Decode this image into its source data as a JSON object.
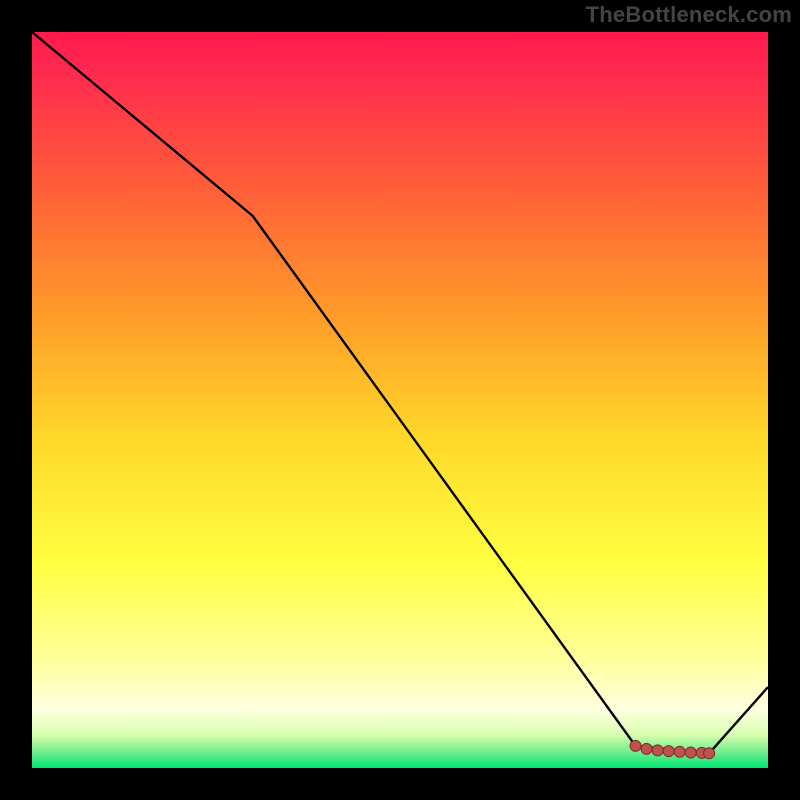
{
  "watermark": "TheBottleneck.com",
  "colors": {
    "background": "#000000",
    "gradient_top": "#ff1a4b",
    "gradient_mid_upper": "#ff8a2a",
    "gradient_mid": "#ffe030",
    "gradient_lower": "#ffff66",
    "gradient_pale": "#ffffcc",
    "gradient_bottom": "#00e673",
    "line": "#000000",
    "marker_fill": "#c0524d",
    "marker_stroke": "#7a2f2b"
  },
  "chart_data": {
    "type": "line",
    "title": "",
    "xlabel": "",
    "ylabel": "",
    "xlim": [
      0,
      100
    ],
    "ylim": [
      0,
      100
    ],
    "series": [
      {
        "name": "primary",
        "x": [
          0,
          30,
          82,
          92,
          100
        ],
        "y": [
          100,
          75,
          3,
          2,
          11
        ]
      }
    ],
    "markers": {
      "name": "highlight",
      "x": [
        82,
        83.5,
        85,
        86.5,
        88,
        89.5,
        91,
        92
      ],
      "y": [
        3,
        2.6,
        2.4,
        2.3,
        2.2,
        2.1,
        2.05,
        2.0
      ]
    }
  }
}
